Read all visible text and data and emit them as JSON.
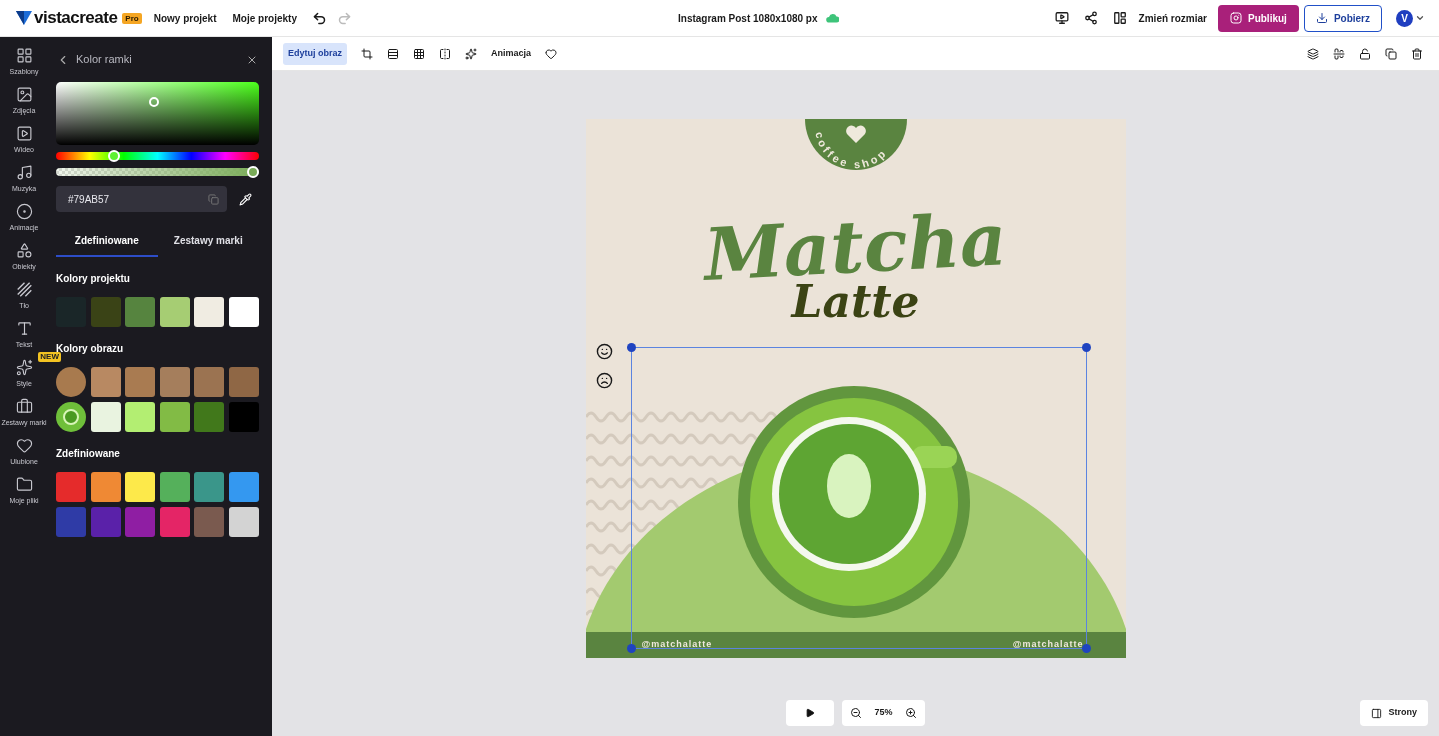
{
  "topbar": {
    "logo": "vistacreate",
    "plan_badge": "Pro",
    "nav": [
      "Nowy projekt",
      "Moje projekty"
    ],
    "document_title": "Instagram Post 1080x1080 px",
    "resize": "Zmień rozmiar",
    "publish": "Publikuj",
    "download": "Pobierz",
    "avatar": "V"
  },
  "rail": [
    {
      "label": "Szablony"
    },
    {
      "label": "Zdjęcia"
    },
    {
      "label": "Wideo"
    },
    {
      "label": "Muzyka"
    },
    {
      "label": "Animacje"
    },
    {
      "label": "Obiekty"
    },
    {
      "label": "Tło"
    },
    {
      "label": "Tekst"
    },
    {
      "label": "Style",
      "badge": "NEW"
    },
    {
      "label": "Zestawy marki"
    },
    {
      "label": "Ulubione"
    },
    {
      "label": "Moje pliki"
    }
  ],
  "panel": {
    "title": "Kolor ramki",
    "hue": {
      "level": 0.27
    },
    "opacity": {
      "level": 1
    },
    "hex": "#79AB57",
    "tabs": [
      {
        "label": "Zdefiniowane",
        "selected": true
      },
      {
        "label": "Zestawy marki",
        "selected": false
      }
    ],
    "sections": [
      {
        "title": "Kolory projektu",
        "swatches": [
          {
            "kind": "color",
            "color": "#1a2628"
          },
          {
            "kind": "color",
            "color": "#3a4316"
          },
          {
            "kind": "color",
            "color": "#56843f"
          },
          {
            "kind": "color",
            "color": "#a6cd73"
          },
          {
            "kind": "color",
            "color": "#f0ece2"
          },
          {
            "kind": "color",
            "color": "#ffffff"
          }
        ]
      },
      {
        "title": "Kolory obrazu",
        "swatches": [
          {
            "kind": "texture",
            "color": "#a87a4e"
          },
          {
            "kind": "color",
            "color": "#b88962"
          },
          {
            "kind": "color",
            "color": "#a97b51"
          },
          {
            "kind": "color",
            "color": "#a57e5c"
          },
          {
            "kind": "color",
            "color": "#9b7351"
          },
          {
            "kind": "color",
            "color": "#8f6745"
          },
          {
            "kind": "photo",
            "color": "#6fbf3a"
          },
          {
            "kind": "color",
            "color": "#e9f3e0"
          },
          {
            "kind": "color",
            "color": "#b3ee72"
          },
          {
            "kind": "color",
            "color": "#82bb45"
          },
          {
            "kind": "color",
            "color": "#41781b"
          },
          {
            "kind": "color",
            "color": "#000000"
          }
        ]
      },
      {
        "title": "Zdefiniowane",
        "swatches": [
          {
            "kind": "color",
            "color": "#e52b2b"
          },
          {
            "kind": "color",
            "color": "#ef8934"
          },
          {
            "kind": "color",
            "color": "#fde94a"
          },
          {
            "kind": "color",
            "color": "#55b05b"
          },
          {
            "kind": "color",
            "color": "#3a968a"
          },
          {
            "kind": "color",
            "color": "#3498f0"
          },
          {
            "kind": "color",
            "color": "#2f3ba6"
          },
          {
            "kind": "color",
            "color": "#5a21a9"
          },
          {
            "kind": "color",
            "color": "#8f1ea3"
          },
          {
            "kind": "color",
            "color": "#e42566"
          },
          {
            "kind": "color",
            "color": "#7a5a4f"
          },
          {
            "kind": "color",
            "color": "#d3d3d3"
          }
        ]
      }
    ]
  },
  "toolbar": {
    "edit_image": {
      "label": "Edytuj obraz",
      "selected": true
    },
    "animation": "Animacja"
  },
  "poster": {
    "badge": "coffee shop",
    "title": "Matcha",
    "subtitle": "Latte",
    "handles": [
      "@matchalatte",
      "@matchalatte"
    ]
  },
  "bottom": {
    "zoom": "75%",
    "pages": "Strony"
  }
}
